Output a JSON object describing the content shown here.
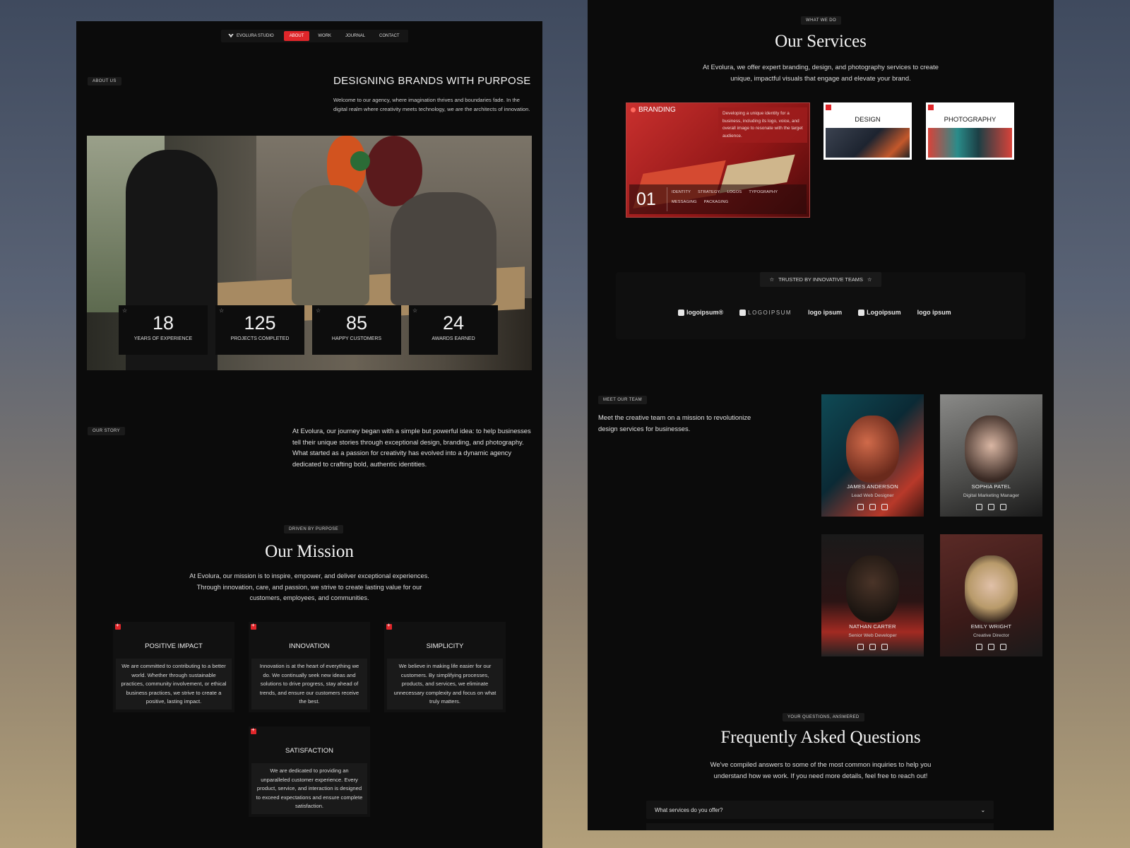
{
  "nav": {
    "brand": "EVOLURA STUDIO",
    "items": [
      {
        "label": "ABOUT",
        "active": true
      },
      {
        "label": "WORK",
        "active": false
      },
      {
        "label": "JOURNAL",
        "active": false
      },
      {
        "label": "CONTACT",
        "active": false
      }
    ]
  },
  "about": {
    "tag": "ABOUT US",
    "title": "DESIGNING BRANDS WITH PURPOSE",
    "text": "Welcome to our agency, where imagination thrives and boundaries fade. In the digital realm where creativity meets technology, we are the architects of innovation."
  },
  "stats": [
    {
      "value": "18",
      "label": "YEARS OF EXPERIENCE"
    },
    {
      "value": "125",
      "label": "PROJECTS COMPLETED"
    },
    {
      "value": "85",
      "label": "HAPPY CUSTOMERS"
    },
    {
      "value": "24",
      "label": "AWARDS EARNED"
    }
  ],
  "story": {
    "tag": "OUR STORY",
    "text": "At Evolura, our journey began with a simple but powerful idea: to help businesses tell their unique stories through exceptional design, branding, and photography. What started as a passion for creativity has evolved into a dynamic agency dedicated to crafting bold, authentic identities."
  },
  "mission": {
    "tag": "DRIVEN BY PURPOSE",
    "title": "Our Mission",
    "text": "At Evolura, our mission is to inspire, empower, and deliver exceptional experiences. Through innovation, care, and passion, we strive to create lasting value for our customers, employees, and communities.",
    "values": [
      {
        "title": "POSITIVE IMPACT",
        "text": "We are committed to contributing to a better world. Whether through sustainable practices, community involvement, or ethical business practices, we strive to create a positive, lasting impact."
      },
      {
        "title": "INNOVATION",
        "text": "Innovation is at the heart of everything we do. We continually seek new ideas and solutions to drive progress, stay ahead of trends, and ensure our customers receive the best."
      },
      {
        "title": "SIMPLICITY",
        "text": "We believe in making life easier for our customers. By simplifying processes, products, and services, we eliminate unnecessary complexity and focus on what truly matters."
      },
      {
        "title": "SATISFACTION",
        "text": "We are dedicated to providing an unparalleled customer experience. Every product, service, and interaction is designed to exceed expectations and ensure complete satisfaction."
      }
    ]
  },
  "services": {
    "tag": "WHAT WE DO",
    "title": "Our Services",
    "text": "At Evolura, we offer expert branding, design, and photography services to create unique, impactful visuals that engage and elevate your brand.",
    "main": {
      "label": "BRANDING",
      "desc": "Developing a unique identity for a business, including its logo, voice, and overall image to resonate with the target audience.",
      "number": "01",
      "tags": [
        "IDENTITY",
        "STRATEGY",
        "LOGOS",
        "TYPOGRAPHY",
        "MESSAGING",
        "PACKAGING"
      ]
    },
    "others": [
      {
        "label": "DESIGN"
      },
      {
        "label": "PHOTOGRAPHY"
      }
    ]
  },
  "trusted": {
    "label": "TRUSTED BY INNOVATIVE TEAMS",
    "logos": [
      "logoipsum®",
      "LOGOIPSUM",
      "logo ipsum",
      "Logoipsum",
      "logo ipsum"
    ]
  },
  "team": {
    "tag": "MEET OUR TEAM",
    "text": "Meet the creative team on a mission to revolutionize design services for businesses.",
    "members": [
      {
        "name": "JAMES ANDERSON",
        "role": "Lead Web Designer"
      },
      {
        "name": "SOPHIA PATEL",
        "role": "Digital Marketing Manager"
      },
      {
        "name": "NATHAN CARTER",
        "role": "Senior Web Developer"
      },
      {
        "name": "EMILY WRIGHT",
        "role": "Creative Director"
      }
    ]
  },
  "faq": {
    "tag": "YOUR QUESTIONS, ANSWERED",
    "title": "Frequently Asked Questions",
    "text": "We've compiled answers to some of the most common inquiries to help you understand how we work. If you need more details, feel free to reach out!",
    "items": [
      {
        "question": "What services do you offer?"
      }
    ]
  },
  "colors": {
    "accent": "#e0262a",
    "panel": "#0b0b0b"
  }
}
